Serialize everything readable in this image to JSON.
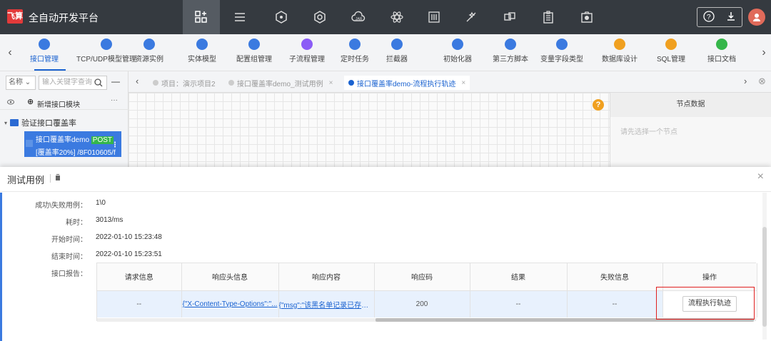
{
  "app": {
    "logo_text": "飞算",
    "title": "全自动开发平台"
  },
  "top_icons": [
    "grid-add-icon",
    "list-icon",
    "hexagon-icon",
    "hexagon-gear-icon",
    "jar-cloud-icon",
    "atom-icon",
    "sliders-icon",
    "magic-wand-icon",
    "link-icon",
    "clipboard-icon",
    "camera-box-icon"
  ],
  "toolbar": {
    "items": [
      {
        "label": "接口管理",
        "color": "#3b7ae0"
      },
      {
        "label": "TCP/UDP模型管理",
        "color": "#3b7ae0"
      },
      {
        "label": "资源实例",
        "color": "#3b7ae0"
      },
      {
        "label": "实体模型",
        "color": "#3b7ae0"
      },
      {
        "label": "配置组管理",
        "color": "#3b7ae0"
      },
      {
        "label": "子流程管理",
        "color": "#8b5cf6"
      },
      {
        "label": "定时任务",
        "color": "#3b7ae0"
      },
      {
        "label": "拦截器",
        "color": "#3b7ae0"
      },
      {
        "label": "初始化器",
        "color": "#3b7ae0"
      },
      {
        "label": "第三方脚本",
        "color": "#3b7ae0"
      },
      {
        "label": "变量字段类型",
        "color": "#3b7ae0"
      },
      {
        "label": "数据库设计",
        "color": "#f0a020"
      },
      {
        "label": "SQL管理",
        "color": "#f0a020"
      },
      {
        "label": "接口文档",
        "color": "#35b64a"
      }
    ]
  },
  "left_panel": {
    "select_label": "名称",
    "search_placeholder": "输入关键字查询",
    "new_module": "新增接口模块",
    "folder": "验证接口覆盖率",
    "api_name": "接口覆盖率demo",
    "api_method": "POST",
    "api_path": "[覆盖率20%] /8F010605/f"
  },
  "tabs": [
    {
      "label": "项目：演示项目2"
    },
    {
      "label": "接口覆盖率demo_测试用例"
    },
    {
      "label": "接口覆盖率demo-流程执行轨迹"
    }
  ],
  "node_panel": {
    "title": "节点数据",
    "empty": "请先选择一个节点"
  },
  "dialog": {
    "title": "测试用例",
    "fields": [
      {
        "key": "成功\\失败用例：",
        "value": "1\\0"
      },
      {
        "key": "耗时：",
        "value": "3013/ms"
      },
      {
        "key": "开始时间：",
        "value": "2022-01-10 15:23:48"
      },
      {
        "key": "结束时间：",
        "value": "2022-01-10 15:23:51"
      },
      {
        "key": "接口报告：",
        "value": ""
      }
    ],
    "report": {
      "headers": [
        "请求信息",
        "响应头信息",
        "响应内容",
        "响应码",
        "结果",
        "失败信息",
        "操作"
      ],
      "row": {
        "request": "--",
        "headers": "{\"X-Content-Type-Options\":\"...",
        "content": "{\"msg\":\"该黑名单记录已存在...",
        "code": "200",
        "result": "--",
        "fail": "--",
        "action": "流程执行轨迹"
      }
    }
  }
}
